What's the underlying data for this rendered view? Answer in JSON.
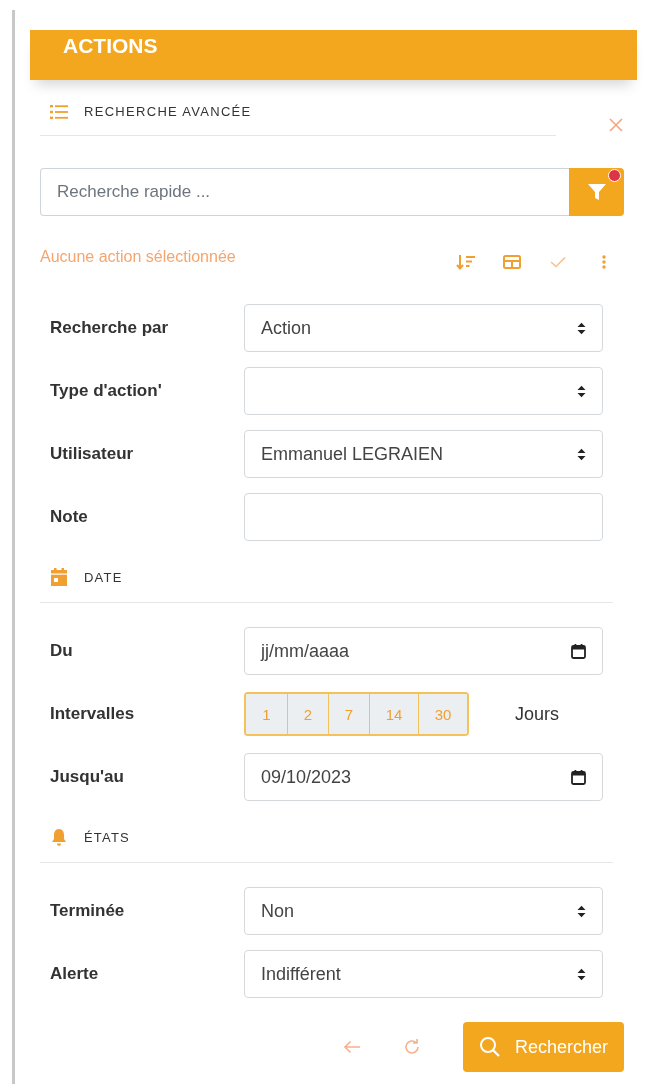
{
  "header": {
    "title": "ACTIONS"
  },
  "advanced_search": {
    "label": "RECHERCHE AVANCÉE"
  },
  "quick_search": {
    "placeholder": "Recherche rapide ...",
    "filter_active": true
  },
  "selection_status": "Aucune action sélectionnée",
  "form": [
    {
      "kind": "select",
      "label": "Recherche par",
      "value": "Action"
    },
    {
      "kind": "select",
      "label": "Type d'action'"
    },
    {
      "kind": "select",
      "label": "Utilisateur",
      "value": "Emmanuel LEGRAIEN"
    },
    {
      "kind": "text",
      "label": "Note"
    },
    {
      "kind": "dates",
      "label": "DATE"
    },
    {
      "kind": "date",
      "label": "Du",
      "placeholder": "jj/mm/aaaa"
    },
    {
      "kind": "intervals",
      "label": "Intervalles",
      "options": [
        "1",
        "2",
        "7",
        "14",
        "30"
      ],
      "unit": "Jours"
    },
    {
      "kind": "date",
      "label": "Jusqu'au",
      "value": "09/10/2023"
    },
    {
      "kind": "states",
      "label": "ÉTATS"
    },
    {
      "kind": "select",
      "label": "Terminée",
      "value": "Non"
    },
    {
      "kind": "select",
      "label": "Alerte",
      "value": "Indifférent"
    }
  ],
  "submit": {
    "label": "Rechercher"
  }
}
